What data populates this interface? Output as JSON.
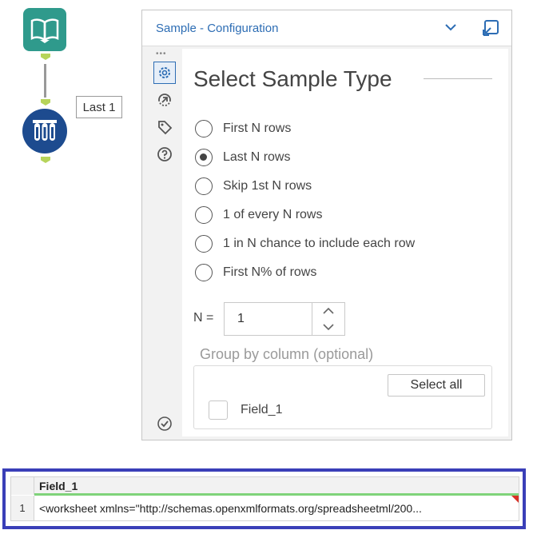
{
  "canvas": {
    "input_node_icon": "book-icon",
    "sample_node_icon": "test-tubes-icon",
    "sample_node_label": "Last 1"
  },
  "panel": {
    "title": "Sample - Configuration",
    "header_icons": [
      "chevron-down-icon",
      "dock-icon"
    ],
    "rail_icons": [
      "gear-icon",
      "navigate-icon",
      "tag-icon",
      "help-icon",
      "check-circle-icon"
    ],
    "heading": "Select Sample Type",
    "options": [
      {
        "label": "First N rows",
        "checked": false
      },
      {
        "label": "Last N rows",
        "checked": true
      },
      {
        "label": "Skip 1st N rows",
        "checked": false
      },
      {
        "label": "1 of every N rows",
        "checked": false
      },
      {
        "label": "1 in N chance to include each row",
        "checked": false
      },
      {
        "label": "First N% of rows",
        "checked": false
      }
    ],
    "n_label": "N =",
    "n_value": "1",
    "group_label": "Group by column (optional)",
    "select_all_label": "Select all",
    "fields": [
      {
        "label": "Field_1",
        "checked": false
      }
    ]
  },
  "results": {
    "column_header": "Field_1",
    "rows": [
      {
        "num": "1",
        "value": "<worksheet xmlns=\"http://schemas.openxmlformats.org/spreadsheetml/200..."
      }
    ]
  },
  "colors": {
    "accent": "#2d6db4",
    "input_node": "#2f9a8c",
    "sample_node": "#1d4b8f",
    "results_border": "#3a3fb8",
    "header_bar": "#7fd37a"
  }
}
